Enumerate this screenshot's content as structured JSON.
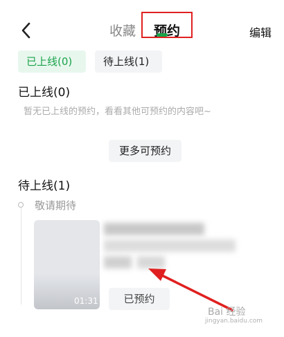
{
  "header": {
    "back_icon": "chevron-left-icon",
    "tabs": [
      {
        "label": "收藏",
        "active": false
      },
      {
        "label": "预约",
        "active": true
      }
    ],
    "edit_label": "编辑"
  },
  "filters": [
    {
      "label": "已上线(0)",
      "selected": true
    },
    {
      "label": "待上线(1)",
      "selected": false
    }
  ],
  "online_section": {
    "title": "已上线(0)",
    "empty_text": "暂无已上线的预约，看看其他可预约的内容吧~"
  },
  "more_button": "更多可预约",
  "upcoming_section": {
    "title": "待上线(1)",
    "group_label": "敬请期待",
    "item": {
      "duration": "01:31",
      "status_button": "已预约"
    }
  },
  "watermark": {
    "text": "Bai 经验",
    "url": "jingyan.baidu.com"
  },
  "colors": {
    "accent": "#1aa34a",
    "highlight": "#e02020"
  }
}
